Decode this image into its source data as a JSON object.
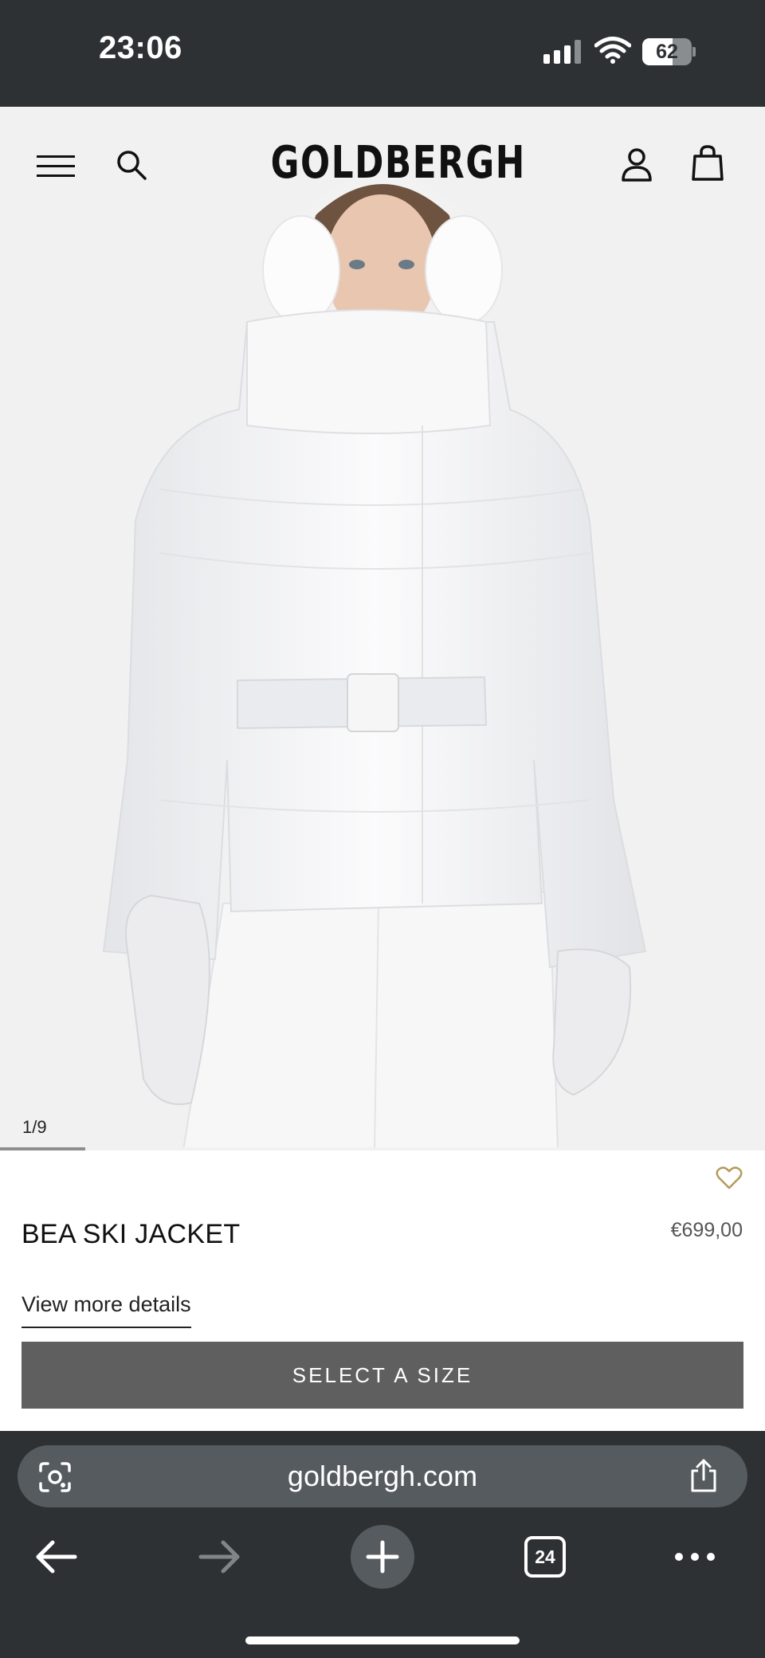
{
  "status_bar": {
    "time": "23:06",
    "battery_level": "62",
    "battery_fraction": 0.62
  },
  "header": {
    "brand": "GOLDBERGH"
  },
  "gallery": {
    "counter": "1/9",
    "current": 1,
    "total": 9
  },
  "product": {
    "name": "BEA SKI JACKET",
    "price": "€699,00",
    "details_link": "View more details",
    "select_size_label": "SELECT A SIZE"
  },
  "browser": {
    "url": "goldbergh.com",
    "tab_count": "24"
  },
  "icons": [
    "menu-icon",
    "search-icon",
    "account-icon",
    "shopping-bag-icon",
    "heart-icon",
    "lens-icon",
    "share-icon",
    "back-arrow-icon",
    "forward-arrow-icon",
    "plus-icon",
    "more-icon"
  ],
  "colors": {
    "status_bar": "#2e3133",
    "image_bg": "#f1f1f2",
    "select_size_bg": "#5f5f5f",
    "wishlist": "#b59a5b",
    "url_bar": "#565b60"
  }
}
